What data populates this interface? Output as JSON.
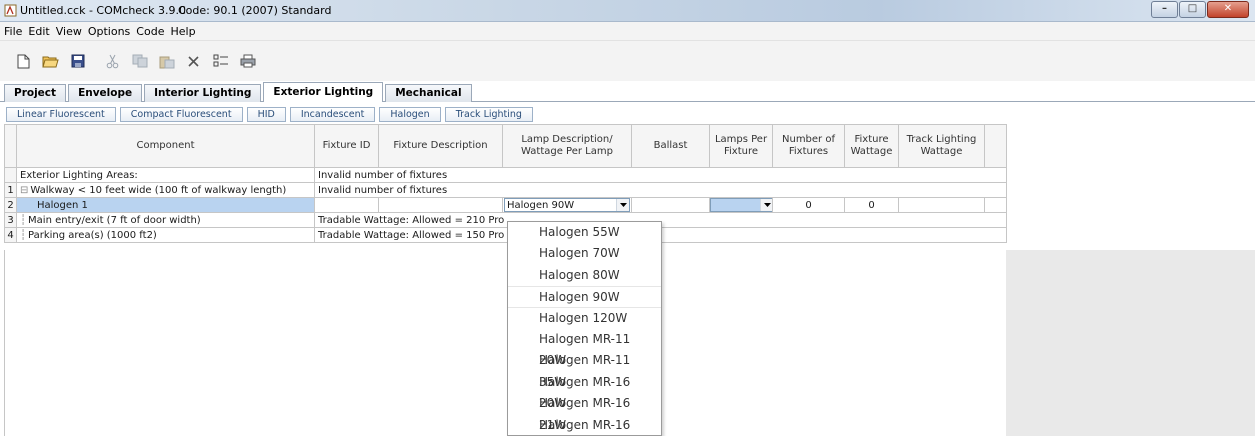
{
  "window": {
    "title": "Untitled.cck - COMcheck 3.9.0",
    "code": "Code: 90.1 (2007) Standard"
  },
  "menu": [
    "File",
    "Edit",
    "View",
    "Options",
    "Code",
    "Help"
  ],
  "toolbar": [
    "new-icon",
    "open-icon",
    "save-icon",
    "cut-icon",
    "copy-icon",
    "paste-icon",
    "delete-icon",
    "list-icon",
    "print-icon"
  ],
  "tabs": [
    {
      "label": "Project",
      "active": false
    },
    {
      "label": "Envelope",
      "active": false
    },
    {
      "label": "Interior Lighting",
      "active": false
    },
    {
      "label": "Exterior Lighting",
      "active": true
    },
    {
      "label": "Mechanical",
      "active": false
    }
  ],
  "subtabs": [
    "Linear Fluorescent",
    "Compact Fluorescent",
    "HID",
    "Incandescent",
    "Halogen",
    "Track Lighting"
  ],
  "grid": {
    "headers": [
      "Component",
      "Fixture ID",
      "Fixture Description",
      "Lamp Description/ Wattage Per Lamp",
      "Ballast",
      "Lamps Per Fixture",
      "Number of Fixtures",
      "Fixture Wattage",
      "Track Lighting Wattage"
    ],
    "rows": {
      "r0": {
        "component": "Exterior Lighting Areas:",
        "note": "Invalid number of fixtures"
      },
      "r1": {
        "num": "1",
        "component": "Walkway < 10 feet wide (100 ft of walkway length)",
        "note": "Invalid number of fixtures"
      },
      "r2": {
        "num": "2",
        "component": "Halogen 1",
        "lamp": "Halogen 90W",
        "fixtures": "0",
        "wattage": "0"
      },
      "r3": {
        "num": "3",
        "component": "Main entry/exit (7 ft of door width)",
        "note": "Tradable Wattage:  Allowed = 210   Pro"
      },
      "r4": {
        "num": "4",
        "component": "Parking area(s) (1000 ft2)",
        "note": "Tradable Wattage:  Allowed = 150   Pro"
      }
    }
  },
  "dropdown": {
    "items": [
      "Halogen 55W",
      "Halogen 70W",
      "Halogen 80W",
      "Halogen 90W",
      "Halogen 120W",
      "Halogen MR-11 20W",
      "Halogen MR-11 35W",
      "Halogen MR-16 20W",
      "Halogen MR-16 21W",
      "Halogen MR-16 35W"
    ],
    "selected": "Halogen 90W"
  }
}
